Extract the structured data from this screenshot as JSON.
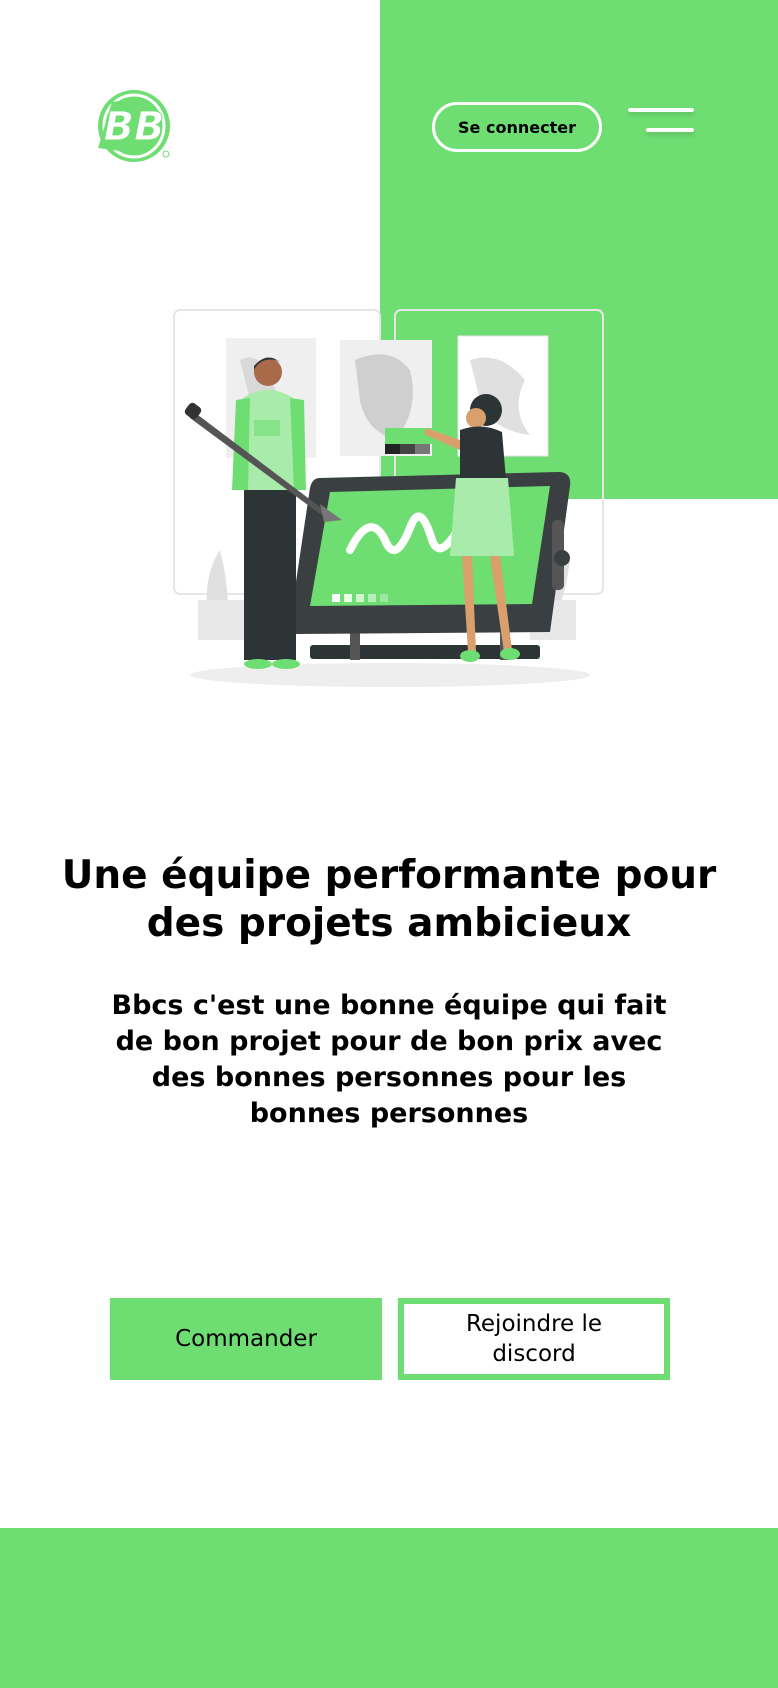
{
  "brand": {
    "logo_text": "BB",
    "accent_color": "#6fde72"
  },
  "header": {
    "login_label": "Se connecter",
    "menu_icon": "hamburger-menu-icon"
  },
  "hero": {
    "illustration": "designers-working-on-drawing-tablet-illustration",
    "title": "Une équipe performante pour des projets ambicieux",
    "description": "Bbcs c'est une bonne équipe qui fait de bon projet pour de bon prix avec des bonnes personnes pour les bonnes personnes"
  },
  "actions": {
    "order_label": "Commander",
    "discord_label": "Rejoindre le discord"
  }
}
